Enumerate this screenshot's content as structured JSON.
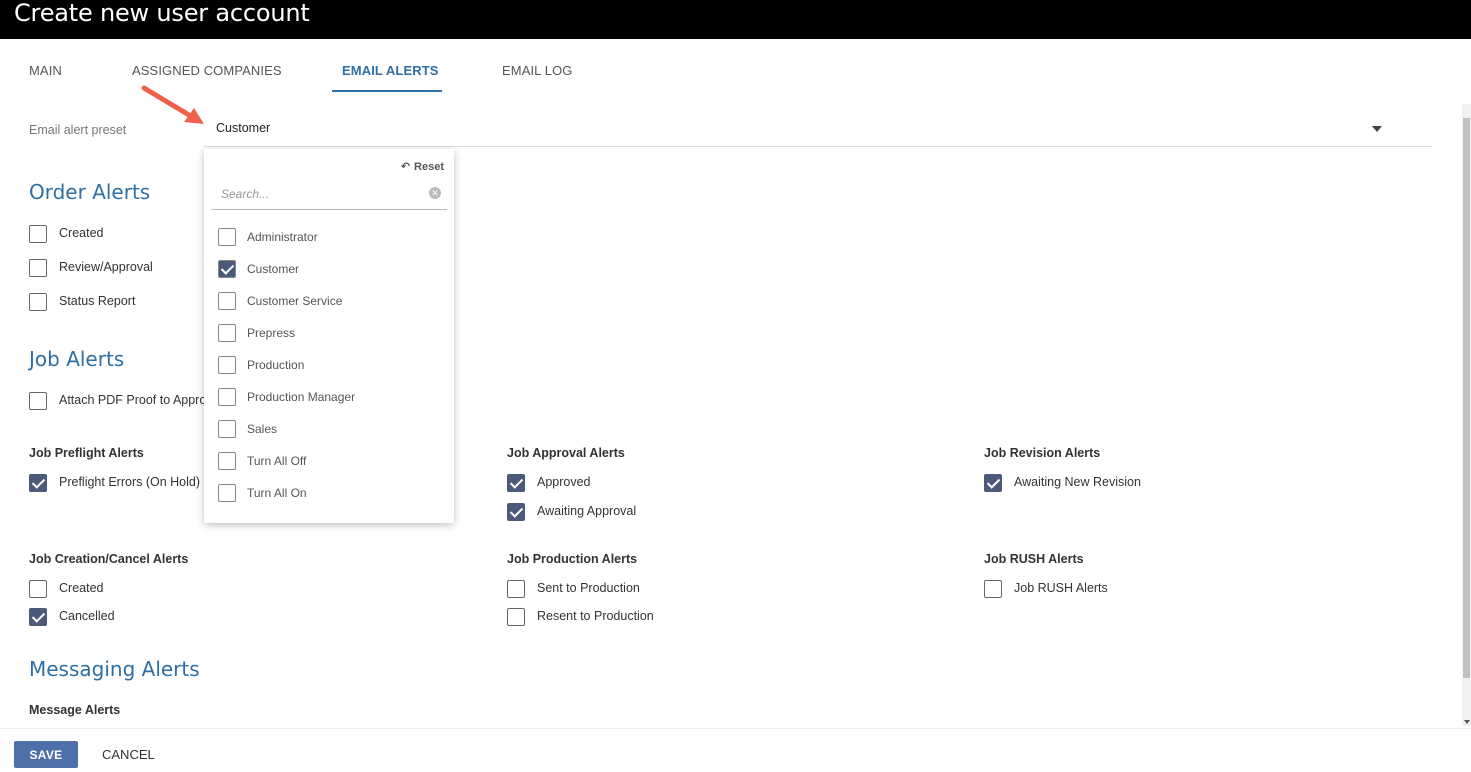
{
  "window": {
    "title": "Create new user account"
  },
  "tabs": [
    {
      "label": "MAIN"
    },
    {
      "label": "ASSIGNED COMPANIES"
    },
    {
      "label": "EMAIL ALERTS"
    },
    {
      "label": "EMAIL LOG"
    }
  ],
  "active_tab": "EMAIL ALERTS",
  "preset": {
    "label": "Email alert preset",
    "value": "Customer"
  },
  "dropdown": {
    "reset_label": "Reset",
    "search_placeholder": "Search...",
    "options": [
      {
        "label": "Administrator",
        "checked": false
      },
      {
        "label": "Customer",
        "checked": true
      },
      {
        "label": "Customer Service",
        "checked": false
      },
      {
        "label": "Prepress",
        "checked": false
      },
      {
        "label": "Production",
        "checked": false
      },
      {
        "label": "Production Manager",
        "checked": false
      },
      {
        "label": "Sales",
        "checked": false
      },
      {
        "label": "Turn All Off",
        "checked": false
      },
      {
        "label": "Turn All On",
        "checked": false
      }
    ]
  },
  "order_alerts": {
    "title": "Order Alerts",
    "items": [
      {
        "label": "Created",
        "checked": false
      },
      {
        "label": "Review/Approval",
        "checked": false
      },
      {
        "label": "Status Report",
        "checked": false
      }
    ]
  },
  "job_alerts": {
    "title": "Job Alerts",
    "attach": {
      "label": "Attach PDF Proof to Approval Email",
      "checked": false
    },
    "preflight": {
      "title": "Job Preflight Alerts",
      "items": [
        {
          "label": "Preflight Errors (On Hold)",
          "checked": true
        }
      ]
    },
    "approval": {
      "title": "Job Approval Alerts",
      "items": [
        {
          "label": "Approved",
          "checked": true
        },
        {
          "label": "Awaiting Approval",
          "checked": true
        }
      ]
    },
    "revision": {
      "title": "Job Revision Alerts",
      "items": [
        {
          "label": "Awaiting New Revision",
          "checked": true
        }
      ]
    },
    "creation": {
      "title": "Job Creation/Cancel Alerts",
      "items": [
        {
          "label": "Created",
          "checked": false
        },
        {
          "label": "Cancelled",
          "checked": true
        }
      ]
    },
    "production": {
      "title": "Job Production Alerts",
      "items": [
        {
          "label": "Sent to Production",
          "checked": false
        },
        {
          "label": "Resent to Production",
          "checked": false
        }
      ]
    },
    "rush": {
      "title": "Job RUSH Alerts",
      "items": [
        {
          "label": "Job RUSH Alerts",
          "checked": false
        }
      ]
    }
  },
  "messaging_alerts": {
    "title": "Messaging Alerts",
    "group_title": "Message Alerts"
  },
  "footer": {
    "save_label": "SAVE",
    "cancel_label": "CANCEL"
  },
  "colors": {
    "accent": "#2f6fa3",
    "checkbox_checked": "#4b5a7a",
    "save_button": "#4f6fa8",
    "annotation_arrow": "#f0614a"
  },
  "icons": {
    "reset": "undo-arrow-icon",
    "clear_search": "clear-circle-icon",
    "preset_caret": "caret-down-icon"
  }
}
